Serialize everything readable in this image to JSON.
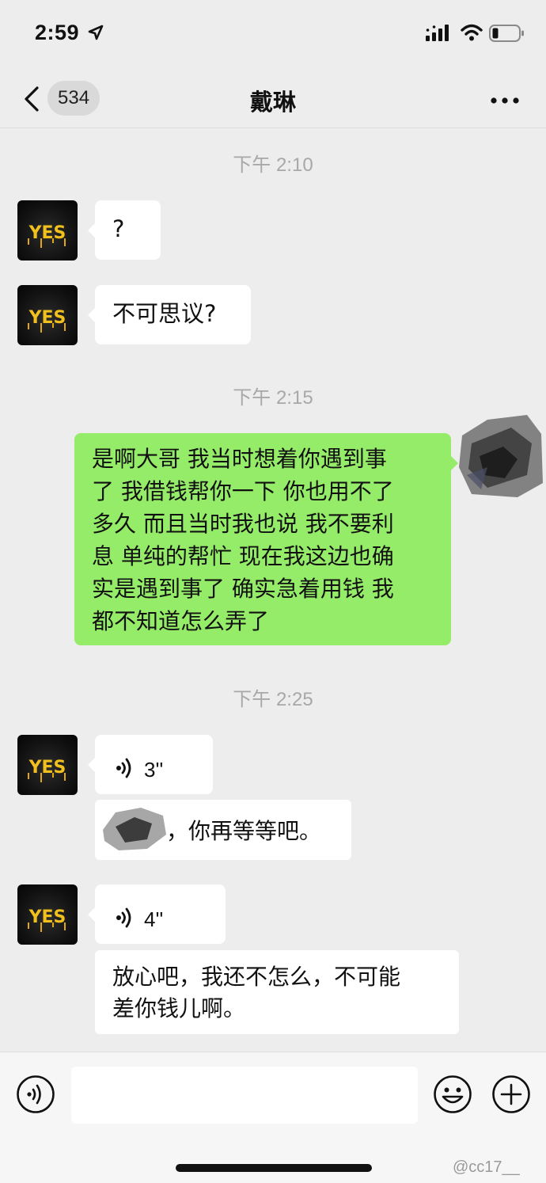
{
  "status_bar": {
    "time": "2:59"
  },
  "nav": {
    "unread_count": "534",
    "title": "戴琳"
  },
  "timestamps": [
    "下午 2:10",
    "下午 2:15",
    "下午 2:25"
  ],
  "avatar_text": "YES",
  "messages": {
    "m1": "?",
    "m2": "不可思议?",
    "m3_lines": [
      "是啊大哥 我当时想着你遇到事",
      "了 我借钱帮你一下 你也用不了",
      "多久 而且当时我也说 我不要利",
      "息 单纯的帮忙 现在我这边也确",
      "实是遇到事了 确实急着用钱 我",
      "都不知道怎么弄了"
    ],
    "voice1_duration": "3''",
    "m4_text": "，你再等等吧。",
    "voice2_duration": "4''",
    "m5_lines": [
      "放心吧，我还不怎么，不可能",
      "差你钱儿啊。"
    ]
  },
  "input": {
    "placeholder": ""
  },
  "watermark": "@cc17__",
  "colors": {
    "background": "#ededed",
    "bubble_self": "#95ec69",
    "bubble_other": "#ffffff",
    "timestamp": "#a8a8a8"
  }
}
